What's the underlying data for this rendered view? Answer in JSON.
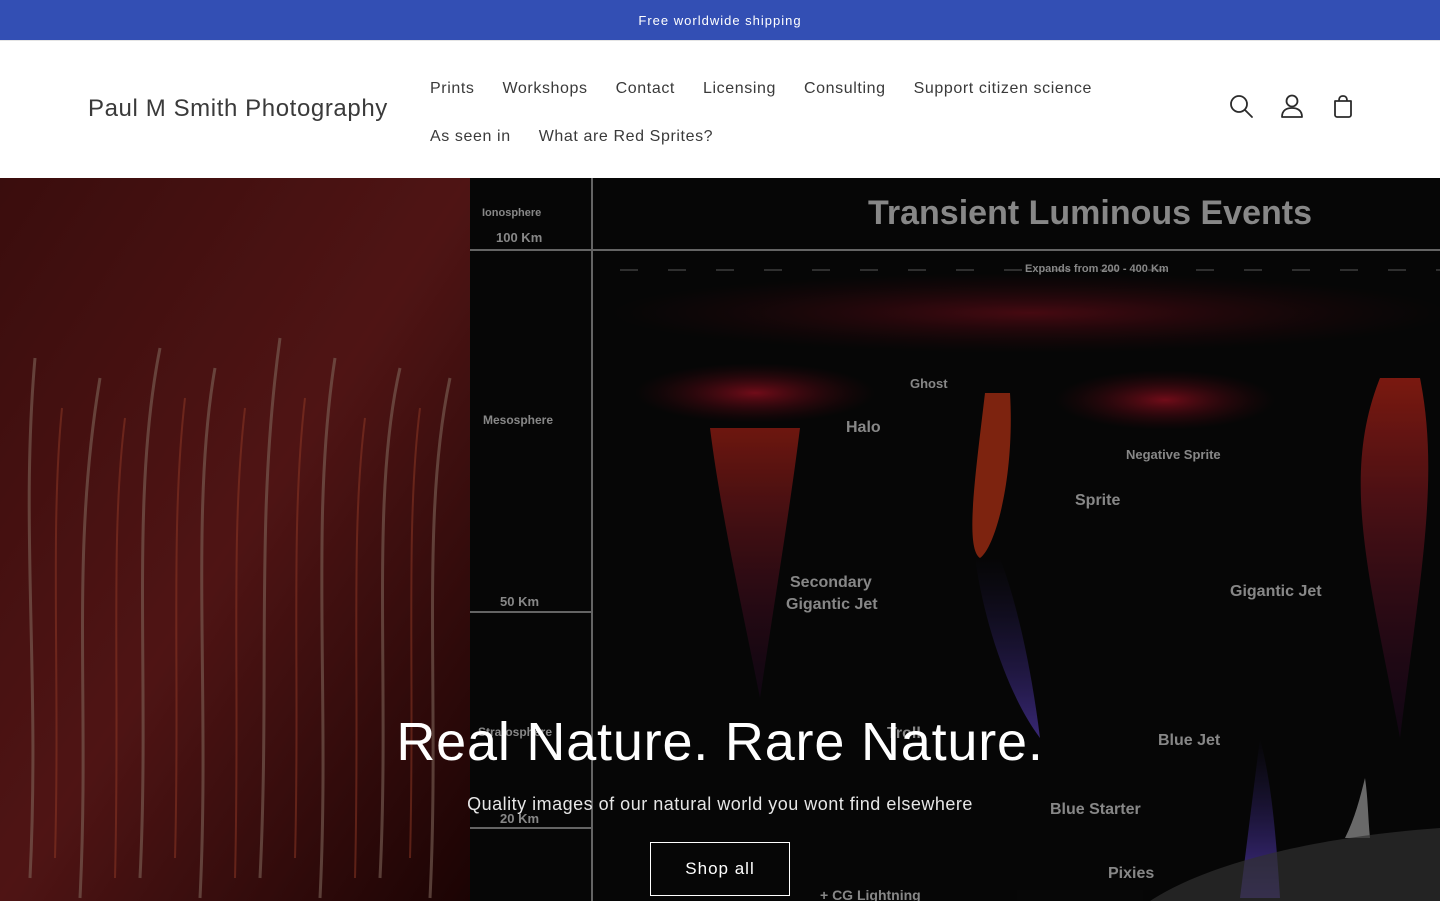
{
  "announcement": {
    "text": "Free worldwide shipping"
  },
  "header": {
    "logo": "Paul M Smith Photography",
    "nav_row1": [
      "Prints",
      "Workshops",
      "Contact",
      "Licensing",
      "Consulting",
      "Support citizen science"
    ],
    "nav_row2": [
      "As seen in",
      "What are Red Sprites?"
    ],
    "icons": [
      "search-icon",
      "account-icon",
      "cart-icon"
    ]
  },
  "hero": {
    "title": "Real Nature. Rare Nature.",
    "subtitle": "Quality images of our natural world you wont find elsewhere",
    "button": "Shop all",
    "image_text": {
      "heading": "Transient Luminous Events",
      "ionosphere": "Ionosphere",
      "km100": "100 Km",
      "mesosphere": "Mesosphere",
      "km50": "50 Km",
      "stratosphere": "Stratosphere",
      "km20": "20 Km",
      "expands": "Expands from 200 - 400 Km",
      "ghost": "Ghost",
      "halo": "Halo",
      "negative_sprite": "Negative Sprite",
      "sprite": "Sprite",
      "secondary_gj": "Secondary",
      "secondary_gj2": "Gigantic Jet",
      "gigantic_jet": "Gigantic Jet",
      "troll": "Troll",
      "blue_jet": "Blue Jet",
      "blue_starter": "Blue Starter",
      "pixies": "Pixies",
      "cg": "+ CG Lightning"
    }
  },
  "colors": {
    "announcement_bg": "#334fb4"
  }
}
